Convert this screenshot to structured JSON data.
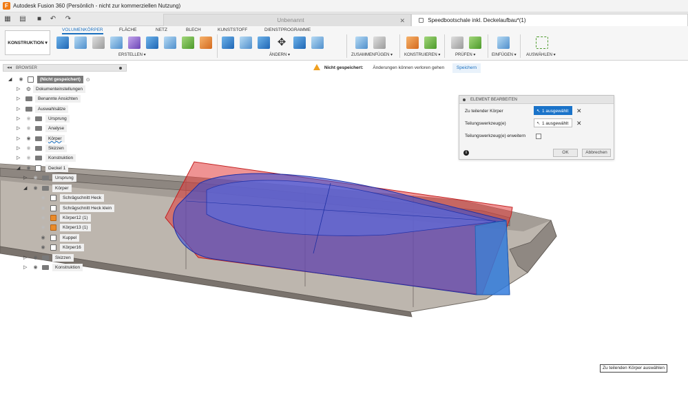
{
  "window": {
    "title": "Autodesk Fusion 360 (Persönlich - nicht zur kommerziellen Nutzung)",
    "logo": "F"
  },
  "tabs": {
    "inactive": "Unbenannt",
    "active": "Speedbootschale inkl. Deckelaufbau*(1)"
  },
  "ribbon": {
    "workspace": "KONSTRUKTION ▾",
    "tabs": [
      "VOLUMENKÖRPER",
      "FLÄCHE",
      "NETZ",
      "BLECH",
      "KUNSTSTOFF",
      "DIENSTPROGRAMME"
    ],
    "groups": [
      "ERSTELLEN ▾",
      "ÄNDERN ▾",
      "ZUSAMMENFÜGEN ▾",
      "KONSTRUIEREN ▾",
      "PRÜFEN ▾",
      "EINFÜGEN ▾",
      "AUSWÄHLEN ▾"
    ]
  },
  "browser": {
    "title": "BROWSER",
    "items": [
      {
        "label": "(Nicht gespeichert)"
      },
      {
        "label": "Dokumenteinstellungen"
      },
      {
        "label": "Benannte Ansichten"
      },
      {
        "label": "Auswahlsätze"
      },
      {
        "label": "Ursprung"
      },
      {
        "label": "Analyse"
      },
      {
        "label": "Körper"
      },
      {
        "label": "Skizzen"
      },
      {
        "label": "Konstruktion"
      },
      {
        "label": "Deckel 1"
      },
      {
        "label": "Ursprung"
      },
      {
        "label": "Körper"
      },
      {
        "label": "Schrägschnitt Heck"
      },
      {
        "label": "Schrägschnitt Heck klein"
      },
      {
        "label": "Körper12 (1)"
      },
      {
        "label": "Körper13 (1)"
      },
      {
        "label": "Kuppel"
      },
      {
        "label": "Körper16"
      },
      {
        "label": "Skizzen"
      },
      {
        "label": "Konstruktion"
      }
    ]
  },
  "warning": {
    "title": "Nicht gespeichert:",
    "message": "Änderungen können verloren gehen",
    "action": "Speichern"
  },
  "dialog": {
    "title": "ELEMENT BEARBEITEN",
    "row1_label": "Zu teilender Körper",
    "row1_value": "1 ausgewählt",
    "row2_label": "Teilungswerkzeug(e)",
    "row2_value": "1 ausgewählt",
    "row3_label": "Teilungswerkzeug(e) erweitern",
    "ok": "OK",
    "cancel": "Abbrechen"
  },
  "tooltip": "Zu teilenden Körper auswählen",
  "colors": {
    "accent": "#1a73c9",
    "selection_red": "#e23a3a",
    "body_blue": "#3a52d6"
  }
}
